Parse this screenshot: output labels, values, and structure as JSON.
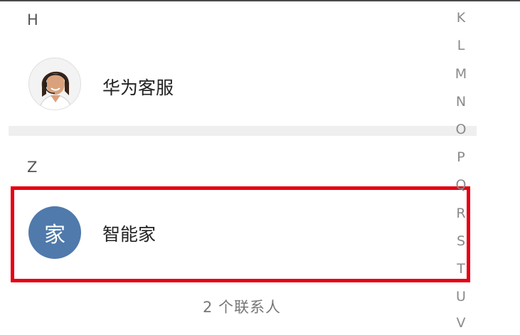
{
  "sections": [
    {
      "letter": "H",
      "contacts": [
        {
          "name": "华为客服",
          "avatar_type": "photo"
        }
      ]
    },
    {
      "letter": "Z",
      "contacts": [
        {
          "name": "智能家",
          "avatar_type": "letter",
          "avatar_letter": "家",
          "avatar_color": "#4f7aab"
        }
      ]
    }
  ],
  "footer": {
    "count_text": "2 个联系人"
  },
  "index_bar": {
    "letters": [
      "K",
      "L",
      "M",
      "N",
      "O",
      "P",
      "Q",
      "R",
      "S",
      "T",
      "U",
      "V"
    ]
  },
  "highlight": {
    "target": "智能家",
    "color": "#e50011"
  }
}
